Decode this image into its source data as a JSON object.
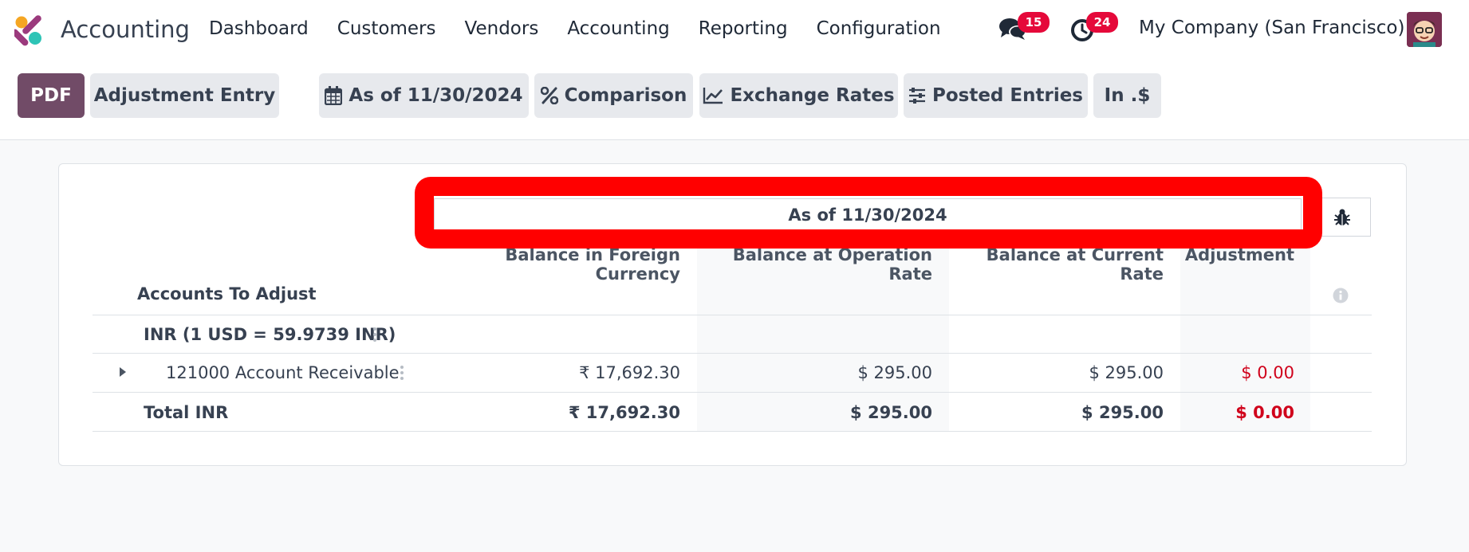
{
  "app": {
    "title": "Accounting",
    "menu": [
      "Dashboard",
      "Customers",
      "Vendors",
      "Accounting",
      "Reporting",
      "Configuration"
    ],
    "messages_count": "15",
    "activities_count": "24",
    "company": "My Company (San Francisco)"
  },
  "toolbar": {
    "pdf_label": "PDF",
    "adjustment_label": "Adjustment Entry",
    "date_filter_label": "As of 11/30/2024",
    "comparison_label": "Comparison",
    "exchange_rates_label": "Exchange Rates",
    "posted_entries_label": "Posted Entries",
    "currency_label": "In .$"
  },
  "report": {
    "period_header": "As of 11/30/2024",
    "columns": [
      "Balance in Foreign Currency",
      "Balance at Operation Rate",
      "Balance at Current Rate",
      "Adjustment"
    ],
    "row_title": "Accounts To Adjust",
    "group_label": "INR (1 USD = 59.9739 INR)",
    "account_line": {
      "label": "121000 Account Receivable",
      "foreign": "₹ 17,692.30",
      "operation": "$ 295.00",
      "current": "$ 295.00",
      "adjustment": "$ 0.00"
    },
    "total_line": {
      "label": "Total INR",
      "foreign": "₹ 17,692.30",
      "operation": "$ 295.00",
      "current": "$ 295.00",
      "adjustment": "$ 0.00"
    }
  },
  "colors": {
    "primary": "#714b67",
    "badge": "#e5093a",
    "negative": "#d0021b",
    "highlight": "#ff0000"
  }
}
